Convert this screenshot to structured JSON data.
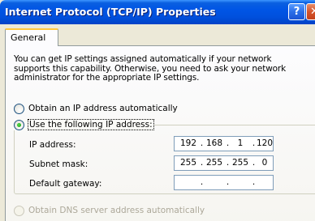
{
  "window": {
    "title": "Internet Protocol (TCP/IP) Properties",
    "help_glyph": "?",
    "close_glyph": "✕"
  },
  "tabs": [
    {
      "label": "General",
      "selected": true
    }
  ],
  "description": "You can get IP settings assigned automatically if your network supports this capability. Otherwise, you need to ask your network administrator for the appropriate IP settings.",
  "ip_mode": {
    "auto_label": "Obtain an IP address automatically",
    "manual_label": "Use the following IP address:",
    "selected": "manual"
  },
  "fields": {
    "ip_address": {
      "label": "IP address:",
      "octets": [
        "192",
        "168",
        "1",
        "120"
      ]
    },
    "subnet_mask": {
      "label": "Subnet mask:",
      "octets": [
        "255",
        "255",
        "255",
        "0"
      ]
    },
    "default_gateway": {
      "label": "Default gateway:",
      "octets": [
        "",
        "",
        "",
        ""
      ]
    }
  },
  "dns_mode": {
    "auto_label": "Obtain DNS server address automatically",
    "enabled": false
  },
  "separator_dot": "."
}
